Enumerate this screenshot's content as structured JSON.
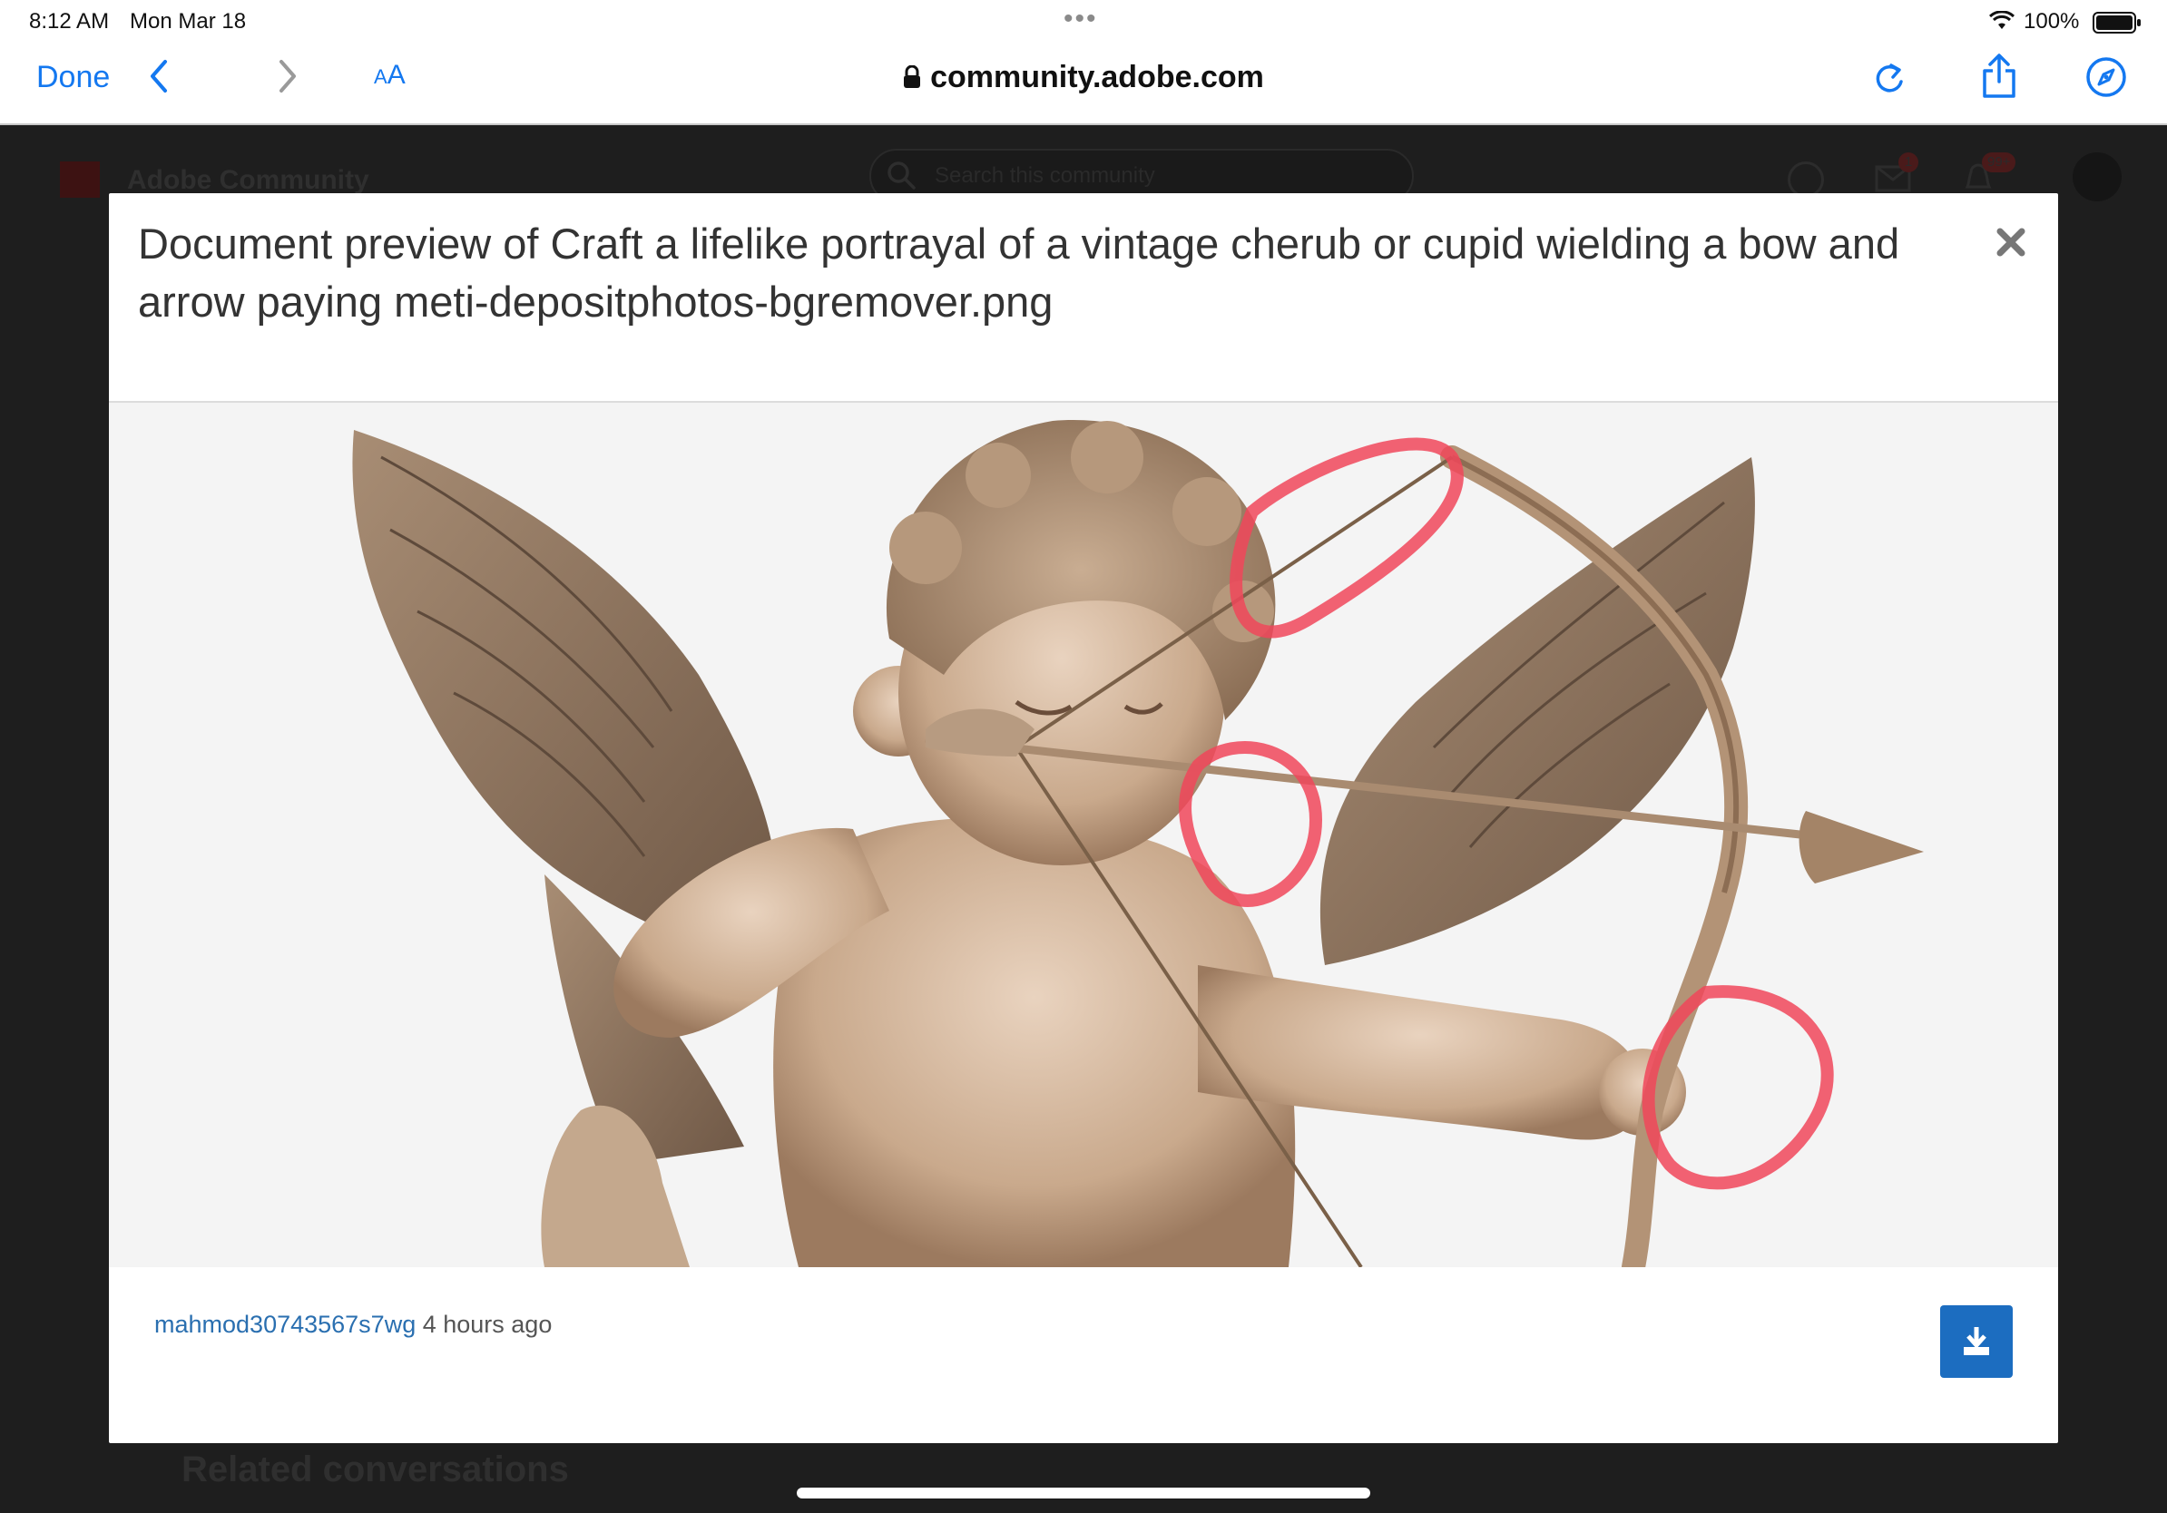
{
  "status_bar": {
    "time": "8:12 AM",
    "date": "Mon Mar 18",
    "battery": "100%"
  },
  "browser": {
    "done_label": "Done",
    "text_size_label_small": "A",
    "text_size_label_large": "A",
    "url": "community.adobe.com"
  },
  "background_page": {
    "brand": "Adobe Community",
    "search_placeholder": "Search this community",
    "message_badge": "1",
    "notification_badge": "99+",
    "related_heading": "Related conversations"
  },
  "modal": {
    "title": "Document preview of Craft a lifelike portrayal of a vintage cherub or cupid wielding a bow and arrow paying meti-depositphotos-bgremover.png",
    "author": "mahmod30743567s7wg",
    "time_ago": "4 hours ago"
  },
  "icons": {
    "close": "close-icon",
    "download": "download-icon"
  },
  "colors": {
    "accent": "#1478f0",
    "download_button": "#1c6dc0",
    "author_link": "#2a6fb0",
    "annotation": "#f0475a"
  }
}
